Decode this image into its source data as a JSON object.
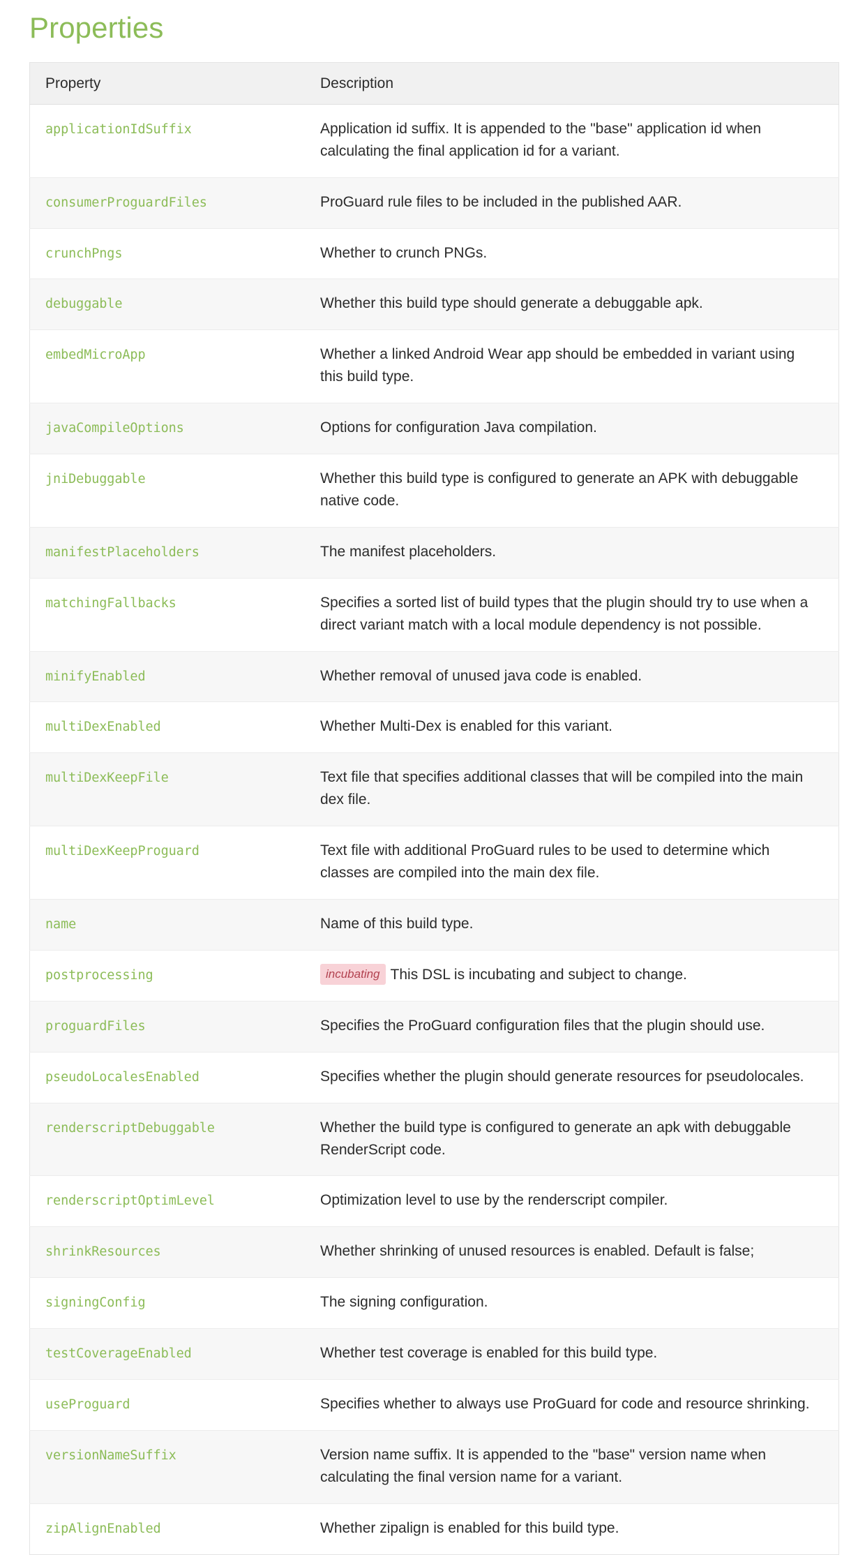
{
  "heading": "Properties",
  "accent_color": "#8cbc58",
  "table": {
    "columns": {
      "property": "Property",
      "description": "Description"
    },
    "rows": [
      {
        "property": "applicationIdSuffix",
        "description": "Application id suffix. It is appended to the \"base\" application id when calculating the final application id for a variant.",
        "badge": ""
      },
      {
        "property": "consumerProguardFiles",
        "description": "ProGuard rule files to be included in the published AAR.",
        "badge": ""
      },
      {
        "property": "crunchPngs",
        "description": "Whether to crunch PNGs.",
        "badge": ""
      },
      {
        "property": "debuggable",
        "description": "Whether this build type should generate a debuggable apk.",
        "badge": ""
      },
      {
        "property": "embedMicroApp",
        "description": "Whether a linked Android Wear app should be embedded in variant using this build type.",
        "badge": ""
      },
      {
        "property": "javaCompileOptions",
        "description": "Options for configuration Java compilation.",
        "badge": ""
      },
      {
        "property": "jniDebuggable",
        "description": "Whether this build type is configured to generate an APK with debuggable native code.",
        "badge": ""
      },
      {
        "property": "manifestPlaceholders",
        "description": "The manifest placeholders.",
        "badge": ""
      },
      {
        "property": "matchingFallbacks",
        "description": "Specifies a sorted list of build types that the plugin should try to use when a direct variant match with a local module dependency is not possible.",
        "badge": ""
      },
      {
        "property": "minifyEnabled",
        "description": "Whether removal of unused java code is enabled.",
        "badge": ""
      },
      {
        "property": "multiDexEnabled",
        "description": "Whether Multi-Dex is enabled for this variant.",
        "badge": ""
      },
      {
        "property": "multiDexKeepFile",
        "description": "Text file that specifies additional classes that will be compiled into the main dex file.",
        "badge": ""
      },
      {
        "property": "multiDexKeepProguard",
        "description": "Text file with additional ProGuard rules to be used to determine which classes are compiled into the main dex file.",
        "badge": ""
      },
      {
        "property": "name",
        "description": "Name of this build type.",
        "badge": ""
      },
      {
        "property": "postprocessing",
        "description": "This DSL is incubating and subject to change.",
        "badge": "incubating"
      },
      {
        "property": "proguardFiles",
        "description": "Specifies the ProGuard configuration files that the plugin should use.",
        "badge": ""
      },
      {
        "property": "pseudoLocalesEnabled",
        "description": "Specifies whether the plugin should generate resources for pseudolocales.",
        "badge": ""
      },
      {
        "property": "renderscriptDebuggable",
        "description": "Whether the build type is configured to generate an apk with debuggable RenderScript code.",
        "badge": ""
      },
      {
        "property": "renderscriptOptimLevel",
        "description": "Optimization level to use by the renderscript compiler.",
        "badge": ""
      },
      {
        "property": "shrinkResources",
        "description": "Whether shrinking of unused resources is enabled. Default is false;",
        "badge": ""
      },
      {
        "property": "signingConfig",
        "description": "The signing configuration.",
        "badge": ""
      },
      {
        "property": "testCoverageEnabled",
        "description": "Whether test coverage is enabled for this build type.",
        "badge": ""
      },
      {
        "property": "useProguard",
        "description": "Specifies whether to always use ProGuard for code and resource shrinking.",
        "badge": ""
      },
      {
        "property": "versionNameSuffix",
        "description": "Version name suffix. It is appended to the \"base\" version name when calculating the final version name for a variant.",
        "badge": ""
      },
      {
        "property": "zipAlignEnabled",
        "description": "Whether zipalign is enabled for this build type.",
        "badge": ""
      }
    ]
  }
}
